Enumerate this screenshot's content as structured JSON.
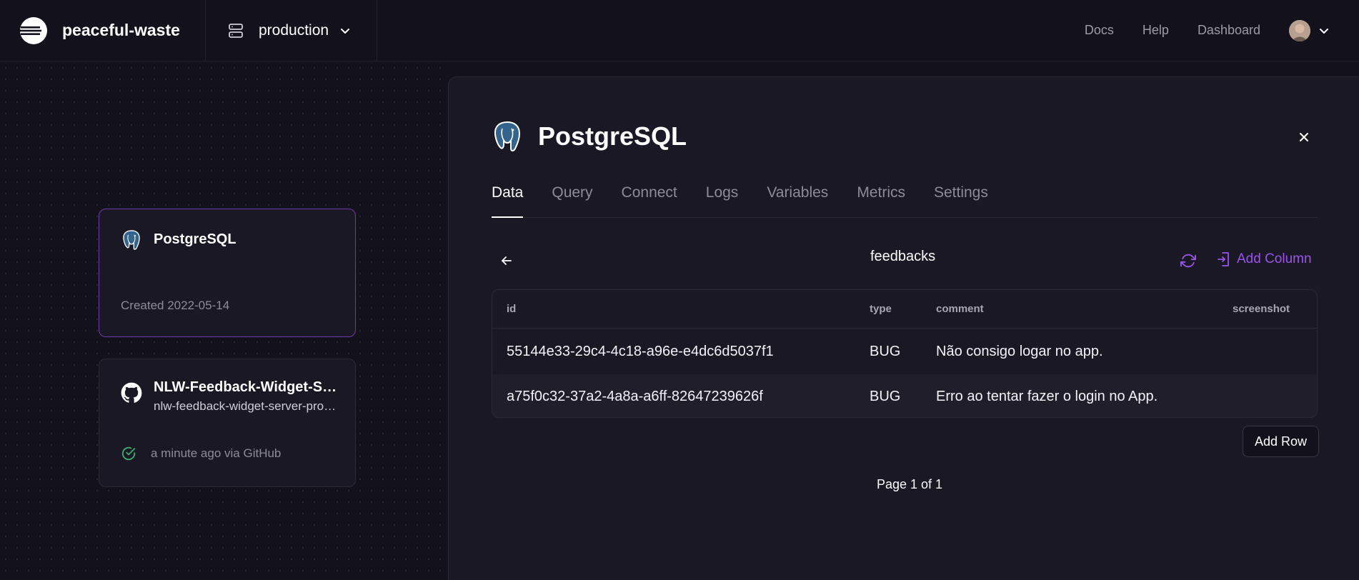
{
  "brand": {
    "name": "peaceful-waste",
    "logo_icon": "railway-logo-icon"
  },
  "environment": {
    "name": "production",
    "icon": "server-icon"
  },
  "nav": {
    "docs": "Docs",
    "help": "Help",
    "dashboard": "Dashboard"
  },
  "canvas": {
    "postgres_card": {
      "title": "PostgreSQL",
      "meta": "Created 2022-05-14"
    },
    "service_card": {
      "title": "NLW-Feedback-Widget-Server",
      "subtitle": "nlw-feedback-widget-server-production",
      "status": "a minute ago via GitHub"
    }
  },
  "panel": {
    "title": "PostgreSQL",
    "tabs": [
      {
        "label": "Data",
        "active": true
      },
      {
        "label": "Query"
      },
      {
        "label": "Connect"
      },
      {
        "label": "Logs"
      },
      {
        "label": "Variables"
      },
      {
        "label": "Metrics"
      },
      {
        "label": "Settings"
      }
    ],
    "table_name": "feedbacks",
    "add_column_label": "Add Column",
    "columns": [
      "id",
      "type",
      "comment",
      "screenshot"
    ],
    "rows": [
      {
        "id": "55144e33-29c4-4c18-a96e-e4dc6d5037f1",
        "type": "BUG",
        "comment": "Não consigo logar no app.",
        "screenshot": ""
      },
      {
        "id": "a75f0c32-37a2-4a8a-a6ff-82647239626f",
        "type": "BUG",
        "comment": "Erro ao tentar fazer o login no App.",
        "screenshot": ""
      }
    ],
    "add_row_label": "Add Row",
    "pagination": "Page 1 of 1"
  },
  "colors": {
    "background": "#13111c",
    "panel": "#1a1824",
    "accent_purple": "#9a55e8",
    "status_green": "#3fae6a"
  }
}
